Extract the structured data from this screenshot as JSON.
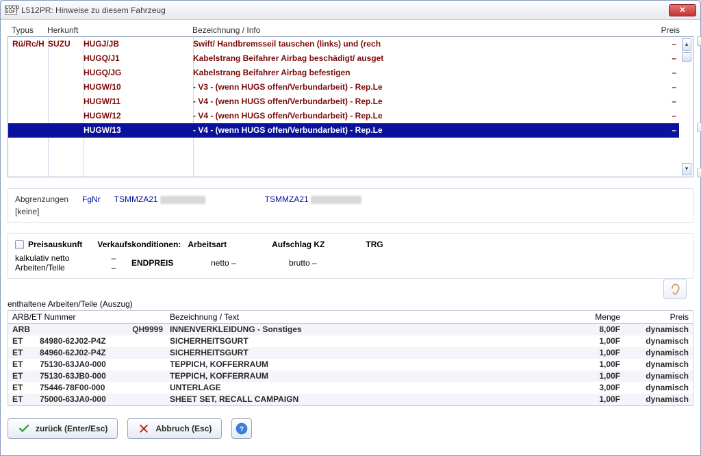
{
  "window": {
    "title": "L512PR: Hinweise zu diesem Fahrzeug"
  },
  "grid": {
    "headers": {
      "typus": "Typus",
      "herkunft": "Herkunft",
      "bezeichnung": "Bezeichnung / Info",
      "preis": "Preis"
    },
    "typus_prefix": "Rü/Rc/H",
    "herkunft_prefix": "SUZU",
    "rows": [
      {
        "code": "HUGJ/JB",
        "bez": "Swift/ Handbremsseil tauschen (links) und (rech",
        "preis": "–",
        "selected": false
      },
      {
        "code": "HUGQ/J1",
        "bez": "Kabelstrang Beifahrer Airbag beschädigt/ ausget",
        "preis": "–",
        "selected": false
      },
      {
        "code": "HUGQ/JG",
        "bez": "Kabelstrang Beifahrer Airbag befestigen",
        "preis": "–",
        "selected": false
      },
      {
        "code": "HUGW/10",
        "bez": "- V3 - (wenn HUGS offen/Verbundarbeit) - Rep.Le",
        "preis": "–",
        "selected": false
      },
      {
        "code": "HUGW/11",
        "bez": "- V4 - (wenn HUGS offen/Verbundarbeit) - Rep.Le",
        "preis": "–",
        "selected": false
      },
      {
        "code": "HUGW/12",
        "bez": "- V4 - (wenn HUGS offen/Verbundarbeit) - Rep.Le",
        "preis": "–",
        "selected": false
      },
      {
        "code": "HUGW/13",
        "bez": "- V4 - (wenn HUGS offen/Verbundarbeit) - Rep.Le",
        "preis": "–",
        "selected": true
      }
    ]
  },
  "abgrenzungen": {
    "label": "Abgrenzungen",
    "fgnr_label": "FgNr",
    "keine": "[keine]",
    "fg_a": "TSMMZA21",
    "fg_b": "TSMMZA21"
  },
  "preisauskunft": {
    "title": "Preisauskunft",
    "verkaufskonditionen": "Verkaufskonditionen:",
    "arbeitsart": "Arbeitsart",
    "aufschlag": "Aufschlag KZ",
    "trg": "TRG",
    "kalk_netto": "kalkulativ netto",
    "arbeiten_teile": "Arbeiten/Teile",
    "dash1": "–",
    "dash2": "–",
    "endpreis": "ENDPREIS",
    "netto": "netto  –",
    "brutto": "brutto   –"
  },
  "arbeiten": {
    "title": "enthaltene Arbeiten/Teile (Auszug)",
    "headers": {
      "num": "ARB/ET Nummer",
      "bez": "Bezeichnung / Text",
      "menge": "Menge",
      "preis": "Preis"
    },
    "rows": [
      {
        "typ": "ARB",
        "num": "QH9999",
        "bez": "INNENVERKLEIDUNG - Sonstiges",
        "menge": "8,00F",
        "preis": "dynamisch"
      },
      {
        "typ": "ET",
        "num": "84980-62J02-P4Z",
        "bez": "SICHERHEITSGURT",
        "menge": "1,00F",
        "preis": "dynamisch"
      },
      {
        "typ": "ET",
        "num": "84960-62J02-P4Z",
        "bez": "SICHERHEITSGURT",
        "menge": "1,00F",
        "preis": "dynamisch"
      },
      {
        "typ": "ET",
        "num": "75130-63JA0-000",
        "bez": "TEPPICH, KOFFERRAUM",
        "menge": "1,00F",
        "preis": "dynamisch"
      },
      {
        "typ": "ET",
        "num": "75130-63JB0-000",
        "bez": "TEPPICH, KOFFERRAUM",
        "menge": "1,00F",
        "preis": "dynamisch"
      },
      {
        "typ": "ET",
        "num": "75446-78F00-000",
        "bez": "UNTERLAGE",
        "menge": "3,00F",
        "preis": "dynamisch"
      },
      {
        "typ": "ET",
        "num": "75000-63JA0-000",
        "bez": "SHEET SET, RECALL CAMPAIGN",
        "menge": "1,00F",
        "preis": "dynamisch"
      }
    ]
  },
  "buttons": {
    "back": "zurück (Enter/Esc)",
    "cancel": "Abbruch (Esc)"
  }
}
